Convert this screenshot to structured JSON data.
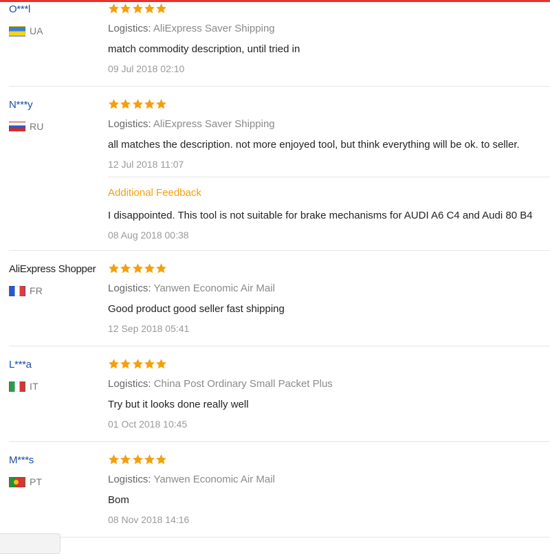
{
  "logistics_label": "Logistics:",
  "additional_feedback_label": "Additional Feedback",
  "colors": {
    "star": "#f5a00b",
    "username": "#1a4fa3",
    "accent_top": "#e8322b"
  },
  "reviews": [
    {
      "user": "O***l",
      "country": "UA",
      "rating": 5,
      "logistics": "AliExpress Saver Shipping",
      "text": "match commodity description, until tried in",
      "date": "09 Jul 2018 02:10"
    },
    {
      "user": "N***y",
      "country": "RU",
      "rating": 5,
      "logistics": "AliExpress Saver Shipping",
      "text": "all matches the description. not more enjoyed tool, but think everything will be ok. to seller.",
      "date": "12 Jul 2018 11:07",
      "additional": {
        "text": "I disappointed. This tool is not suitable for brake mechanisms for AUDI A6 C4 and Audi 80 B4",
        "date": "08 Aug 2018 00:38"
      }
    },
    {
      "user": "AliExpress Shopper",
      "country": "FR",
      "rating": 5,
      "logistics": "Yanwen Economic Air Mail",
      "text": "Good product good seller fast shipping",
      "date": "12 Sep 2018 05:41"
    },
    {
      "user": "L***a",
      "country": "IT",
      "rating": 5,
      "logistics": "China Post Ordinary Small Packet Plus",
      "text": "Try but it looks done really well",
      "date": "01 Oct 2018 10:45"
    },
    {
      "user": "M***s",
      "country": "PT",
      "rating": 5,
      "logistics": "Yanwen Economic Air Mail",
      "text": "Bom",
      "date": "08 Nov 2018 14:16"
    }
  ]
}
